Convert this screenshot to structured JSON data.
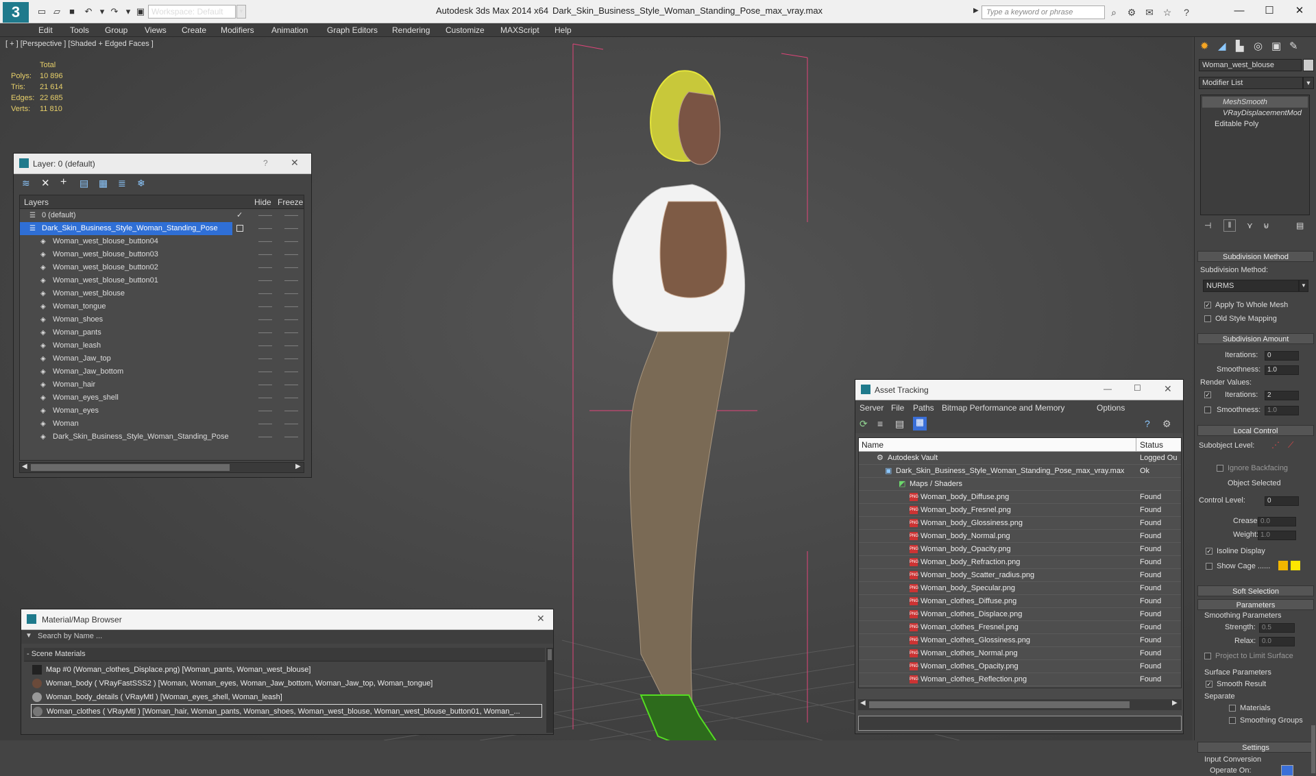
{
  "titlebar": {
    "workspace": "Workspace: Default",
    "app_title": "Autodesk 3ds Max  2014 x64",
    "doc_title": "Dark_Skin_Business_Style_Woman_Standing_Pose_max_vray.max",
    "search_placeholder": "Type a keyword or phrase"
  },
  "menu": [
    "Edit",
    "Tools",
    "Group",
    "Views",
    "Create",
    "Modifiers",
    "Animation",
    "Graph Editors",
    "Rendering",
    "Customize",
    "MAXScript",
    "Help"
  ],
  "viewport": {
    "label": "[ + ] [Perspective ] [Shaded + Edged Faces ]",
    "stats": {
      "header": "Total",
      "rows": [
        {
          "label": "Polys:",
          "value": "10 896"
        },
        {
          "label": "Tris:",
          "value": "21 614"
        },
        {
          "label": "Edges:",
          "value": "22 685"
        },
        {
          "label": "Verts:",
          "value": "11 810"
        }
      ]
    }
  },
  "layers": {
    "title": "Layer: 0 (default)",
    "help": "?",
    "col_layers": "Layers",
    "col_hide": "Hide",
    "col_freeze": "Freeze",
    "rows": [
      {
        "name": "0 (default)"
      },
      {
        "name": "Dark_Skin_Business_Style_Woman_Standing_Pose"
      },
      {
        "name": "Woman_west_blouse_button04"
      },
      {
        "name": "Woman_west_blouse_button03"
      },
      {
        "name": "Woman_west_blouse_button02"
      },
      {
        "name": "Woman_west_blouse_button01"
      },
      {
        "name": "Woman_west_blouse"
      },
      {
        "name": "Woman_tongue"
      },
      {
        "name": "Woman_shoes"
      },
      {
        "name": "Woman_pants"
      },
      {
        "name": "Woman_leash"
      },
      {
        "name": "Woman_Jaw_top"
      },
      {
        "name": "Woman_Jaw_bottom"
      },
      {
        "name": "Woman_hair"
      },
      {
        "name": "Woman_eyes_shell"
      },
      {
        "name": "Woman_eyes"
      },
      {
        "name": "Woman"
      },
      {
        "name": "Dark_Skin_Business_Style_Woman_Standing_Pose"
      }
    ]
  },
  "material_browser": {
    "title": "Material/Map Browser",
    "search_placeholder": "Search by Name ...",
    "group": "- Scene Materials",
    "items": [
      {
        "text": "Map #0 (Woman_clothes_Displace.png) [Woman_pants, Woman_west_blouse]"
      },
      {
        "text": "Woman_body  ( VRayFastSSS2 )  [Woman, Woman_eyes, Woman_Jaw_bottom, Woman_Jaw_top, Woman_tongue]"
      },
      {
        "text": "Woman_body_details  ( VRayMtl )  [Woman_eyes_shell, Woman_leash]"
      },
      {
        "text": "Woman_clothes  ( VRayMtl )  [Woman_hair, Woman_pants, Woman_shoes, Woman_west_blouse, Woman_west_blouse_button01, Woman_..."
      }
    ]
  },
  "asset_tracking": {
    "title": "Asset Tracking",
    "menu": [
      "Server",
      "File",
      "Paths",
      "Bitmap Performance and Memory",
      "Options"
    ],
    "col_name": "Name",
    "col_status": "Status",
    "rows": [
      {
        "name": "Autodesk Vault",
        "status": "Logged Ou"
      },
      {
        "name": "Dark_Skin_Business_Style_Woman_Standing_Pose_max_vray.max",
        "status": "Ok"
      },
      {
        "name": "Maps / Shaders",
        "status": ""
      },
      {
        "name": "Woman_body_Diffuse.png",
        "status": "Found"
      },
      {
        "name": "Woman_body_Fresnel.png",
        "status": "Found"
      },
      {
        "name": "Woman_body_Glossiness.png",
        "status": "Found"
      },
      {
        "name": "Woman_body_Normal.png",
        "status": "Found"
      },
      {
        "name": "Woman_body_Opacity.png",
        "status": "Found"
      },
      {
        "name": "Woman_body_Refraction.png",
        "status": "Found"
      },
      {
        "name": "Woman_body_Scatter_radius.png",
        "status": "Found"
      },
      {
        "name": "Woman_body_Specular.png",
        "status": "Found"
      },
      {
        "name": "Woman_clothes_Diffuse.png",
        "status": "Found"
      },
      {
        "name": "Woman_clothes_Displace.png",
        "status": "Found"
      },
      {
        "name": "Woman_clothes_Fresnel.png",
        "status": "Found"
      },
      {
        "name": "Woman_clothes_Glossiness.png",
        "status": "Found"
      },
      {
        "name": "Woman_clothes_Normal.png",
        "status": "Found"
      },
      {
        "name": "Woman_clothes_Opacity.png",
        "status": "Found"
      },
      {
        "name": "Woman_clothes_Reflection.png",
        "status": "Found"
      }
    ]
  },
  "command_panel": {
    "object_name": "Woman_west_blouse",
    "modifier_list": "Modifier List",
    "stack": [
      "MeshSmooth",
      "VRayDisplacementMod",
      "Editable Poly"
    ],
    "subdivision_method_header": "Subdivision Method",
    "subdivision_method_label": "Subdivision Method:",
    "subdivision_method_value": "NURMS",
    "apply_whole_mesh": "Apply To Whole Mesh",
    "old_style_mapping": "Old Style Mapping",
    "subdivision_amount_header": "Subdivision Amount",
    "iterations_label": "Iterations:",
    "iterations_value": "0",
    "smoothness_label": "Smoothness:",
    "smoothness_value": "1.0",
    "render_values": "Render Values:",
    "render_iterations_value": "2",
    "render_smoothness_value": "1.0",
    "local_control_header": "Local Control",
    "subobject_level": "Subobject Level:",
    "ignore_backfacing": "Ignore Backfacing",
    "object_selected": "Object Selected",
    "control_level": "Control Level:",
    "control_level_value": "0",
    "crease": "Crease:",
    "crease_value": "0.0",
    "weight": "Weight:",
    "weight_value": "1.0",
    "isoline_display": "Isoline Display",
    "show_cage": "Show Cage ......",
    "soft_selection_header": "Soft Selection",
    "parameters_header": "Parameters",
    "smoothing_parameters": "Smoothing Parameters",
    "strength": "Strength:",
    "strength_value": "0.5",
    "relax": "Relax:",
    "relax_value": "0.0",
    "project_limit": "Project to Limit Surface",
    "surface_parameters": "Surface Parameters",
    "smooth_result": "Smooth Result",
    "separate": "Separate",
    "materials": "Materials",
    "smoothing_groups": "Smoothing Groups",
    "settings_header": "Settings",
    "input_conversion": "Input Conversion",
    "operate_on": "Operate On:"
  },
  "colors": {
    "accent": "#3a6fd8",
    "selection": "#2f6fd6",
    "wire_yellow": "#e6e63c",
    "found_text": "#eeeeee"
  }
}
